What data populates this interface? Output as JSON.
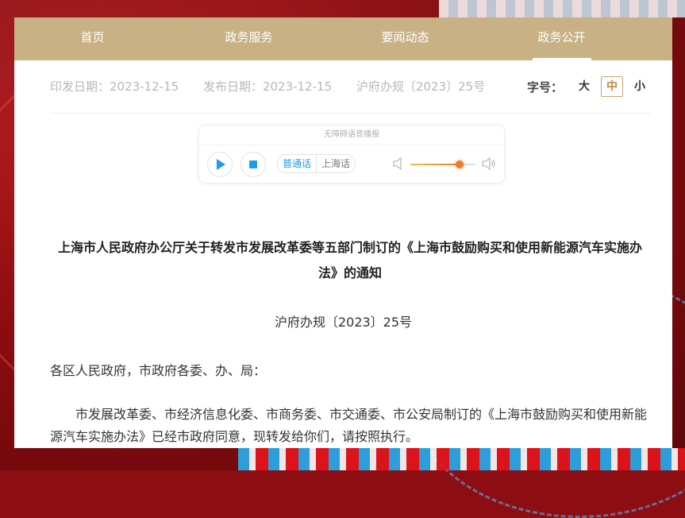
{
  "nav": {
    "items": [
      {
        "label": "首页"
      },
      {
        "label": "政务服务"
      },
      {
        "label": "要闻动态"
      },
      {
        "label": "政务公开"
      }
    ],
    "active_index": 3
  },
  "meta": {
    "issue_date": "印发日期：2023-12-15",
    "publish_date": "发布日期：2023-12-15",
    "doc_number": "沪府办规〔2023〕25号"
  },
  "font_size": {
    "label": "字号：",
    "options": [
      "大",
      "中",
      "小"
    ],
    "selected": "中"
  },
  "player": {
    "title": "无障碍语音播报",
    "languages": [
      "普通话",
      "上海话"
    ],
    "selected_language": "普通话",
    "volume_fraction": 0.76
  },
  "document": {
    "title": "上海市人民政府办公厅关于转发市发展改革委等五部门制订的《上海市鼓励购买和使用新能源汽车实施办法》的通知",
    "doc_number": "沪府办规〔2023〕25号",
    "salutation": "各区人民政府，市政府各委、办、局：",
    "paragraph": "市发展改革委、市经济信息化委、市商务委、市交通委、市公安局制订的《上海市鼓励购买和使用新能源汽车实施办法》已经市政府同意，现转发给你们，请按照执行。"
  },
  "colors": {
    "nav_bg": "#c8b184",
    "accent_blue": "#1c9cea",
    "accent_orange": "#f07b22",
    "background_red": "#8c0d12"
  }
}
